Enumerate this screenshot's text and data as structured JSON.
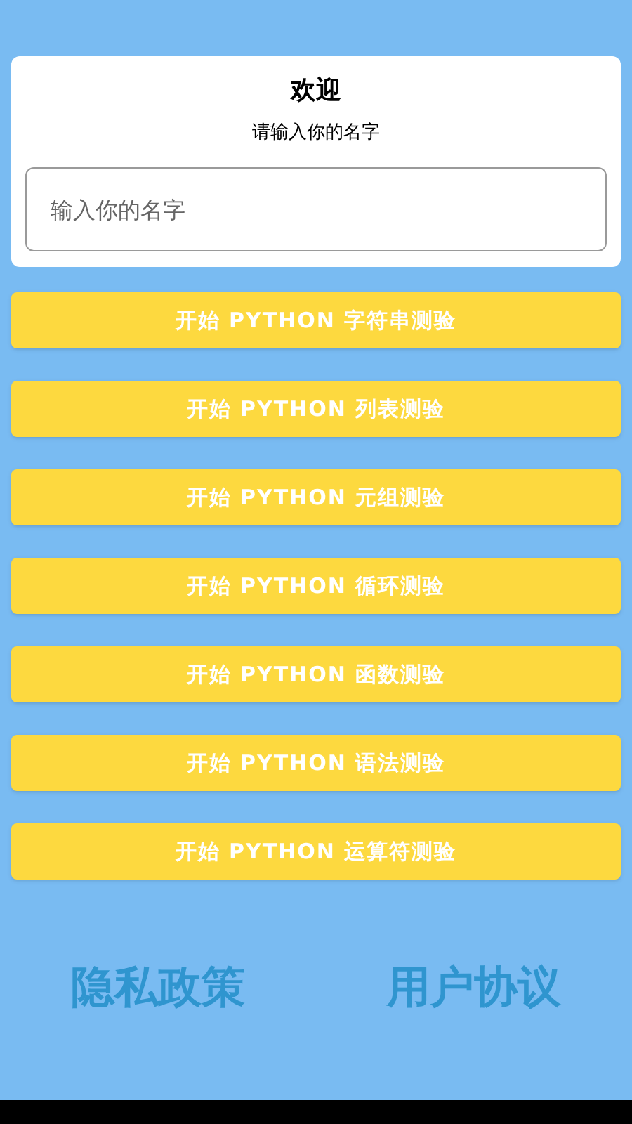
{
  "card": {
    "title": "欢迎",
    "subtitle": "请输入你的名字",
    "name_field": {
      "placeholder": "输入你的名字"
    }
  },
  "quiz_buttons": [
    "开始 PYTHON 字符串测验",
    "开始 PYTHON 列表测验",
    "开始 PYTHON 元组测验",
    "开始 PYTHON 循环测验",
    "开始 PYTHON 函数测验",
    "开始 PYTHON 语法测验",
    "开始 PYTHON 运算符测验"
  ],
  "footer_links": [
    "隐私政策",
    "用户协议"
  ]
}
